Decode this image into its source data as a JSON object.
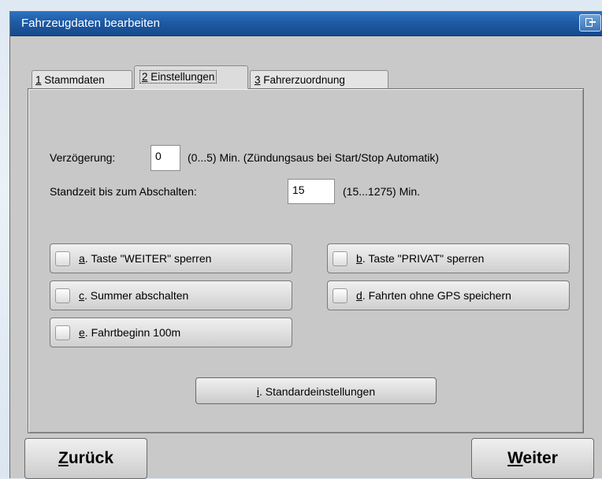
{
  "window": {
    "title": "Fahrzeugdaten bearbeiten",
    "restore_icon": "restore-window-icon"
  },
  "tabs": [
    {
      "num": "1",
      "label": "Stammdaten"
    },
    {
      "num": "2",
      "label": "Einstellungen"
    },
    {
      "num": "3",
      "label": "Fahrerzuordnung"
    }
  ],
  "settings": {
    "delay_label": "Verzögerung:",
    "delay_value": "0",
    "delay_hint": "(0...5) Min. (Zündungsaus bei Start/Stop Automatik)",
    "idle_label": "Standzeit bis zum Abschalten:",
    "idle_value": "15",
    "idle_hint": "(15...1275) Min."
  },
  "options": [
    {
      "key": "a",
      "label": ". Taste \"WEITER\" sperren"
    },
    {
      "key": "b",
      "label": ". Taste \"PRIVAT\" sperren"
    },
    {
      "key": "c",
      "label": ". Summer abschalten"
    },
    {
      "key": "d",
      "label": ". Fahrten ohne GPS speichern"
    },
    {
      "key": "e",
      "label": ". Fahrtbeginn 100m"
    }
  ],
  "defaults_button": {
    "key": "i",
    "label": ". Standardeinstellungen"
  },
  "footer": {
    "back_key": "Z",
    "back_rest": "urück",
    "next_key": "W",
    "next_rest": "eiter"
  }
}
